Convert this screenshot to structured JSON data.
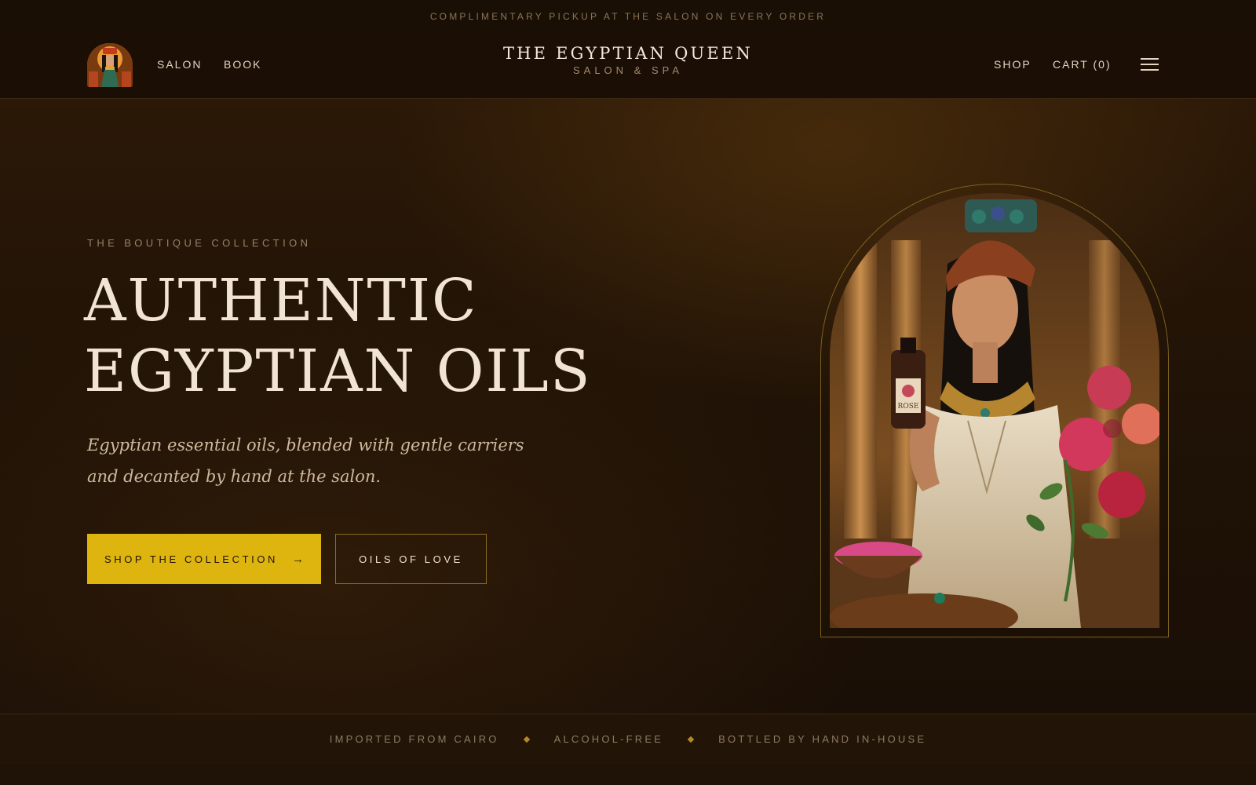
{
  "announcement": "COMPLIMENTARY PICKUP AT THE SALON ON EVERY ORDER",
  "header": {
    "logo_icon": "egyptian-queen-logo-icon",
    "nav_left": [
      "SALON",
      "BOOK"
    ],
    "brand": {
      "name": "THE EGYPTIAN QUEEN",
      "subtitle": "SALON & SPA"
    },
    "nav_right": {
      "shop": "SHOP",
      "cart": "CART (0)"
    },
    "menu_icon": "hamburger-menu-icon"
  },
  "hero": {
    "eyebrow": "THE BOUTIQUE COLLECTION",
    "headline_lines": [
      "AUTHENTIC",
      "EGYPTIAN OILS"
    ],
    "subcopy": "Egyptian essential oils, blended with gentle carriers and decanted by hand at the salon.",
    "primary_cta": {
      "label": "SHOP THE COLLECTION",
      "icon": "arrow-right-icon",
      "glyph": "→"
    },
    "secondary_cta": {
      "label": "OILS OF LOVE"
    },
    "image": {
      "bottle_label": "ROSE"
    }
  },
  "features": [
    "IMPORTED FROM CAIRO",
    "ALCOHOL-FREE",
    "BOTTLED BY HAND IN-HOUSE"
  ],
  "colors": {
    "background": "#1c1005",
    "accent_gold": "#deb40e",
    "frame_gold": "#7b6122",
    "text_light": "#f1e4d2",
    "text_muted": "#8d7a62"
  }
}
